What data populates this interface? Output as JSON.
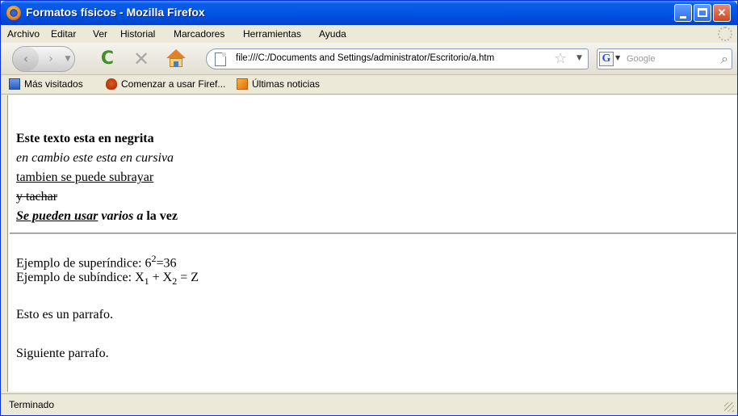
{
  "window": {
    "title": "Formatos físicos - Mozilla Firefox",
    "buttons": {
      "minimize": "",
      "maximize": "",
      "close": "✕"
    }
  },
  "menubar": {
    "items": [
      "Archivo",
      "Editar",
      "Ver",
      "Historial",
      "Marcadores",
      "Herramientas",
      "Ayuda"
    ]
  },
  "navbar": {
    "back_icon": "back-arrow-icon",
    "forward_icon": "forward-arrow-icon",
    "reload_glyph": "C",
    "stop_glyph": "✕",
    "url": "file:///C:/Documents and Settings/administrator/Escritorio/a.htm",
    "star_glyph": "☆",
    "search_placeholder": "Google",
    "search_engine_glyph": "G"
  },
  "bookmarks": {
    "items": [
      "Más visitados",
      "Comenzar a usar Firef...",
      "Últimas noticias"
    ]
  },
  "content": {
    "bold_line": "Este texto esta en negrita",
    "italic_line": "en cambio este esta en cursiva",
    "underline_line": "tambien se puede subrayar",
    "strike_line": "y tachar",
    "mixed": {
      "part1": "Se pueden usar",
      "part2": " varios a",
      "part3": " la vez"
    },
    "superscript": {
      "label": "Ejemplo de superíndice: ",
      "base": "6",
      "exp": "2",
      "rest": "=36"
    },
    "subscript": {
      "label": "Ejemplo de subíndice: ",
      "x": "X",
      "s1": "1",
      "plus": " + X",
      "s2": "2",
      "rest": " = Z"
    },
    "para1": "Esto es un parrafo.",
    "para2": "Siguiente parrafo."
  },
  "status": {
    "text": "Terminado"
  },
  "colors": {
    "titlebar": "#0055e5",
    "chrome": "#ece9d8",
    "reload": "#3f8f2c",
    "home_roof": "#e2802a"
  }
}
